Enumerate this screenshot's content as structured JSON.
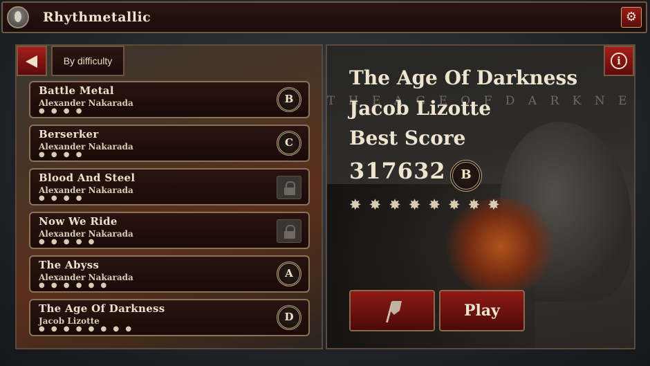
{
  "header": {
    "app_title": "Rhythmetallic",
    "avatar_icon": "avatar-icon",
    "settings_icon": "gear-icon"
  },
  "song_list": {
    "back_icon": "back-arrow-icon",
    "sort_label": "By difficulty",
    "songs": [
      {
        "name": "Battle Metal",
        "artist": "Alexander Nakarada",
        "stars": "● ● ● ●",
        "difficulty_count": 4,
        "grade": "B",
        "locked": false
      },
      {
        "name": "Berserker",
        "artist": "Alexander Nakarada",
        "stars": "● ● ● ●",
        "difficulty_count": 4,
        "grade": "C",
        "locked": false
      },
      {
        "name": "Blood And Steel",
        "artist": "Alexander Nakarada",
        "stars": "● ● ● ●",
        "difficulty_count": 4,
        "grade": "",
        "locked": true
      },
      {
        "name": "Now We Ride",
        "artist": "Alexander Nakarada",
        "stars": "● ● ● ● ●",
        "difficulty_count": 5,
        "grade": "",
        "locked": true
      },
      {
        "name": "The Abyss",
        "artist": "Alexander Nakarada",
        "stars": "● ● ● ● ● ●",
        "difficulty_count": 6,
        "grade": "A",
        "locked": false
      },
      {
        "name": "The Age Of Darkness",
        "artist": "Jacob Lizotte",
        "stars": "● ● ● ● ● ● ● ●",
        "difficulty_count": 8,
        "grade": "D",
        "locked": false
      }
    ]
  },
  "detail": {
    "info_icon": "info-icon",
    "title": "The Age Of Darkness",
    "artist": "Jacob Lizotte",
    "best_score_label": "Best Score",
    "best_score": "317632",
    "best_grade": "B",
    "watermark": "T H E   A G E   O F   D A R K N E S S",
    "stars": "✸✸✸✸✸✸✸✸",
    "difficulty_count": 8,
    "flag_icon": "flag-icon",
    "play_label": "Play"
  },
  "colors": {
    "accent_red": "#8e1a16",
    "frame": "#8a7458",
    "text": "#efe4cf"
  }
}
